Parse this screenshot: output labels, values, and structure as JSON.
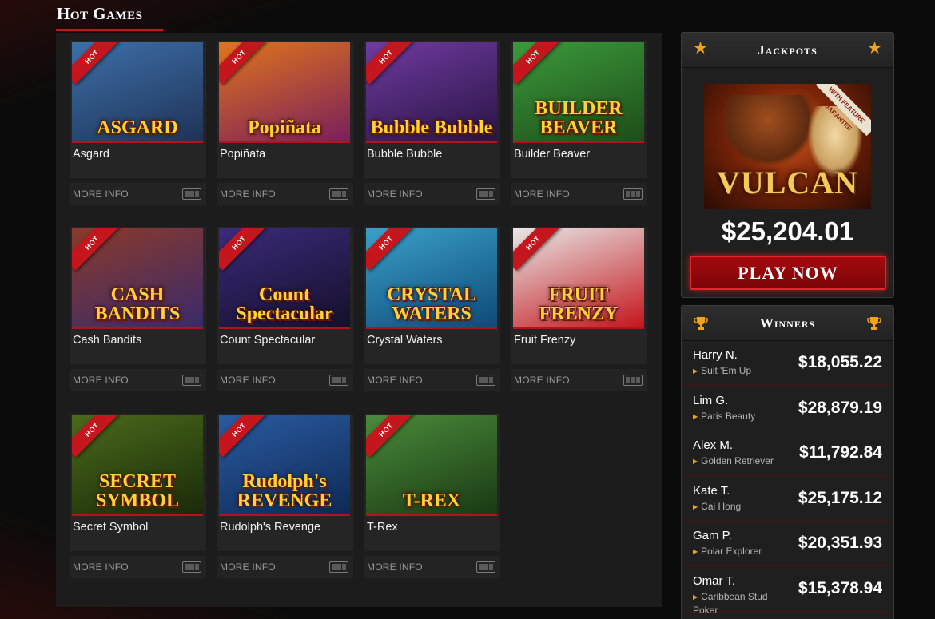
{
  "section": {
    "title": "Hot Games"
  },
  "games": [
    {
      "name": "Asgard",
      "thumb_title": "ASGARD",
      "badge": "HOT",
      "more_info": "MORE INFO",
      "bg": [
        "#3d6fa8",
        "#1f3357"
      ]
    },
    {
      "name": "Popiñata",
      "thumb_title": "Popiñata",
      "badge": "HOT",
      "more_info": "MORE INFO",
      "bg": [
        "#e0741c",
        "#7a1f5c"
      ]
    },
    {
      "name": "Bubble Bubble",
      "thumb_title": "Bubble Bubble",
      "badge": "HOT",
      "more_info": "MORE INFO",
      "bg": [
        "#6f3aa0",
        "#2a1444"
      ]
    },
    {
      "name": "Builder Beaver",
      "thumb_title": "BUILDER BEAVER",
      "badge": "HOT",
      "more_info": "MORE INFO",
      "bg": [
        "#3b9a3a",
        "#1e4d1a"
      ]
    },
    {
      "name": "Cash Bandits",
      "thumb_title": "CASH BANDITS",
      "badge": "HOT",
      "more_info": "MORE INFO",
      "bg": [
        "#8a3a2a",
        "#3a2a6a"
      ]
    },
    {
      "name": "Count Spectacular",
      "thumb_title": "Count Spectacular",
      "badge": "HOT",
      "more_info": "MORE INFO",
      "bg": [
        "#3b2a7a",
        "#14102a"
      ]
    },
    {
      "name": "Crystal Waters",
      "thumb_title": "CRYSTAL WATERS",
      "badge": "HOT",
      "more_info": "MORE INFO",
      "bg": [
        "#3aa0c8",
        "#0e4a7a"
      ]
    },
    {
      "name": "Fruit Frenzy",
      "thumb_title": "FRUIT FRENZY",
      "badge": "HOT",
      "more_info": "MORE INFO",
      "bg": [
        "#e8e8e8",
        "#c4161c"
      ]
    },
    {
      "name": "Secret Symbol",
      "thumb_title": "SECRET SYMBOL",
      "badge": "HOT",
      "more_info": "MORE INFO",
      "bg": [
        "#4a6a1a",
        "#1a2a0a"
      ]
    },
    {
      "name": "Rudolph's Revenge",
      "thumb_title": "Rudolph's REVENGE",
      "badge": "HOT",
      "more_info": "MORE INFO",
      "bg": [
        "#2a5aa0",
        "#0e2a55"
      ]
    },
    {
      "name": "T-Rex",
      "thumb_title": "T-REX",
      "badge": "HOT",
      "more_info": "MORE INFO",
      "bg": [
        "#4a8a3a",
        "#1a3a14"
      ]
    }
  ],
  "jackpots": {
    "title": "Jackpots",
    "image_title": "VULCAN",
    "image_ribbon": "WITH FEATURE GUARANTEE",
    "amount": "$25,204.01",
    "play_button": "PLAY NOW"
  },
  "winners": {
    "title": "Winners",
    "list": [
      {
        "name": "Harry N.",
        "game": "Suit 'Em Up",
        "amount": "$18,055.22"
      },
      {
        "name": "Lim G.",
        "game": "Paris Beauty",
        "amount": "$28,879.19"
      },
      {
        "name": "Alex M.",
        "game": "Golden Retriever",
        "amount": "$11,792.84"
      },
      {
        "name": "Kate T.",
        "game": "Cai Hong",
        "amount": "$25,175.12"
      },
      {
        "name": "Gam P.",
        "game": "Polar Explorer",
        "amount": "$20,351.93"
      },
      {
        "name": "Omar T.",
        "game": "Caribbean Stud Poker",
        "amount": "$15,378.94"
      }
    ]
  },
  "colors": {
    "accent_red": "#c4161c",
    "gold": "#f3a31c",
    "panel": "#1c1c1c"
  },
  "icons": {
    "star": "star-icon",
    "trophy": "trophy-icon",
    "slot": "slot-machine-icon"
  }
}
